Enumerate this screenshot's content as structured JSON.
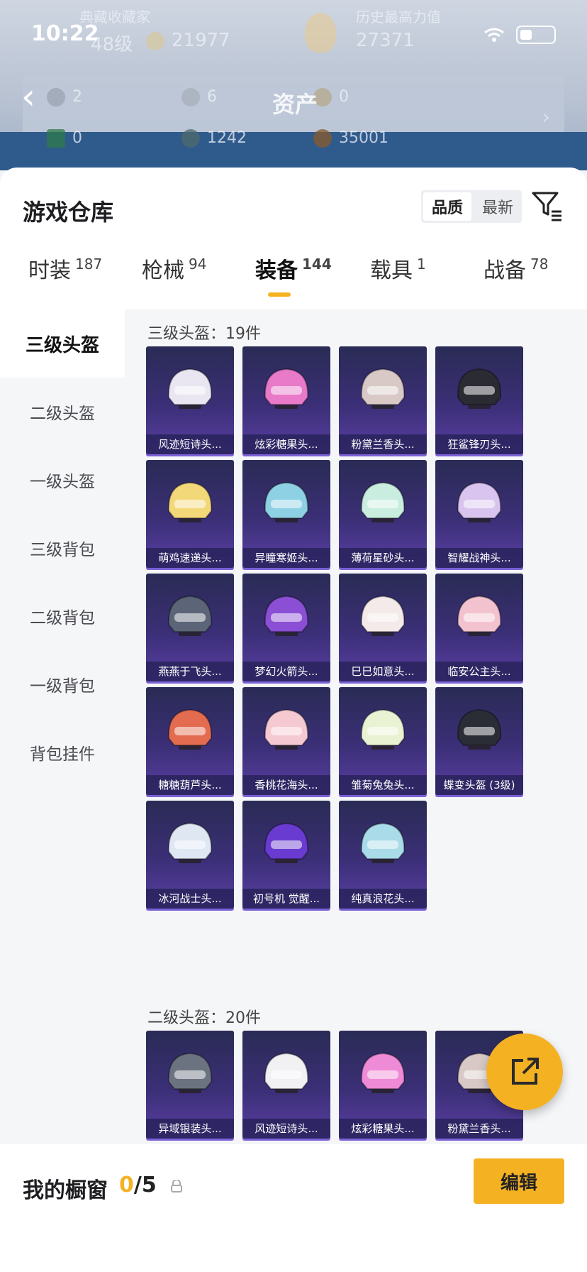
{
  "status": {
    "time": "10:22"
  },
  "header": {
    "faded_labels": {
      "collect": "典藏收藏家",
      "history": "历史最高力值"
    },
    "level": "48级",
    "coins_top": "21977",
    "power": "27371",
    "title": "资产",
    "assets_row1": [
      "2",
      "6",
      "0"
    ],
    "assets_row2": [
      "0",
      "1242",
      "35001"
    ]
  },
  "sheet": {
    "title": "游戏仓库",
    "sort": {
      "quality": "品质",
      "newest": "最新"
    },
    "tabs": [
      {
        "label": "时装",
        "count": "187"
      },
      {
        "label": "枪械",
        "count": "94"
      },
      {
        "label": "装备",
        "count": "144"
      },
      {
        "label": "载具",
        "count": "1"
      },
      {
        "label": "战备",
        "count": "78"
      }
    ],
    "active_tab": 2,
    "sidebar": [
      "三级头盔",
      "二级头盔",
      "一级头盔",
      "三级背包",
      "二级背包",
      "一级背包",
      "背包挂件"
    ],
    "sections": [
      {
        "title": "三级头盔：19件",
        "items": [
          "风迹短诗头...",
          "炫彩糖果头...",
          "粉黛兰香头...",
          "狂鲨锋刃头...",
          "萌鸡速递头...",
          "异瞳寒姬头...",
          "薄荷星砂头...",
          "智耀战神头...",
          "燕燕于飞头...",
          "梦幻火箭头...",
          "巳巳如意头...",
          "临安公主头...",
          "糖糖葫芦头...",
          "香桃花海头...",
          "雏菊兔兔头...",
          "蝶变头盔 (3级)",
          "冰河战士头...",
          "初号机 觉醒...",
          "纯真浪花头..."
        ]
      },
      {
        "title": "二级头盔：20件",
        "items": [
          "异域银装头...",
          "风迹短诗头...",
          "炫彩糖果头...",
          "粉黛兰香头..."
        ]
      }
    ],
    "helmet_colors": [
      "#e9e6f2",
      "#e979c9",
      "#d8c9c7",
      "#2b2b33",
      "#f3d87a",
      "#8fd1e4",
      "#c9eee0",
      "#d9c4ef",
      "#5b6577",
      "#8b4fd6",
      "#f4eaea",
      "#f2c3cf",
      "#e36b4f",
      "#f5c9d2",
      "#e9f3d4",
      "#2a2d36",
      "#dfe7f3",
      "#6a3bd0",
      "#a9dbe9",
      "#6b7380",
      "#f1f0f3",
      "#ef8ad6",
      "#d8c9c7"
    ]
  },
  "bottom": {
    "title": "我的橱窗",
    "count_used": "0",
    "count_total": "/5",
    "edit": "编辑"
  },
  "colors": {
    "accent": "#f4b223",
    "card_bg": "#3b2f77"
  }
}
